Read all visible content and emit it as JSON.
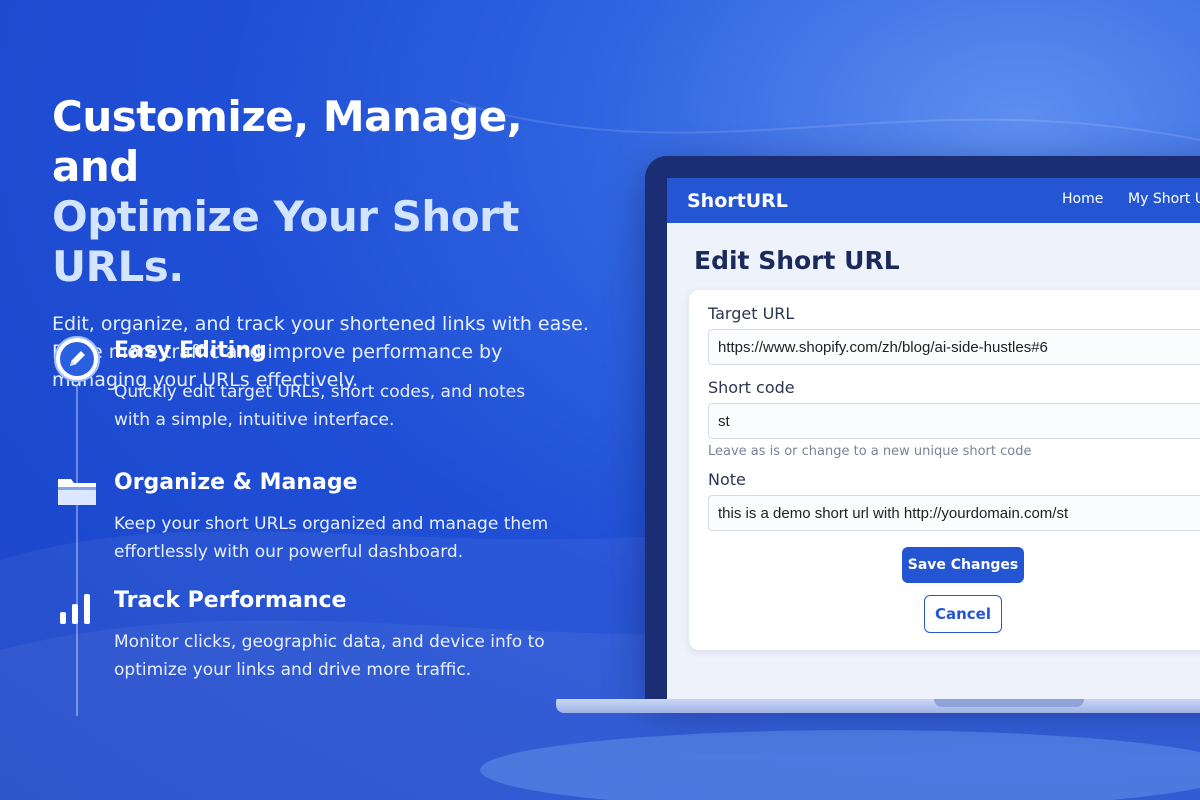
{
  "hero": {
    "title_line1": "Customize, Manage, and",
    "title_line2": "Optimize Your Short URLs.",
    "subtitle": "Edit, organize, and track your shortened links with ease. Drive more traffic and improve performance by managing your URLs effectively."
  },
  "features": [
    {
      "icon": "pencil-icon",
      "title": "Easy Editing",
      "desc": "Quickly edit target URLs, short codes, and notes with a simple, intuitive interface."
    },
    {
      "icon": "folder-icon",
      "title": "Organize & Manage",
      "desc": "Keep your short URLs organized and manage them effortlessly with our powerful dashboard."
    },
    {
      "icon": "bar-chart-icon",
      "title": "Track Performance",
      "desc": "Monitor clicks, geographic data, and device info to optimize your links and drive more traffic."
    }
  ],
  "app": {
    "brand": "ShortURL",
    "nav": [
      "Home",
      "My Short U"
    ],
    "page_title": "Edit Short URL",
    "form": {
      "target_label": "Target URL",
      "target_value": "https://www.shopify.com/zh/blog/ai-side-hustles#6",
      "code_label": "Short code",
      "code_value": "st",
      "code_hint": "Leave as is or change to a new unique short code",
      "note_label": "Note",
      "note_value": "this is a demo short url with  http://yourdomain.com/st",
      "save_label": "Save Changes",
      "cancel_label": "Cancel"
    }
  },
  "colors": {
    "background": "#1f4fd6",
    "accent": "#2456d4",
    "title_highlight": "#d2e4ff"
  }
}
